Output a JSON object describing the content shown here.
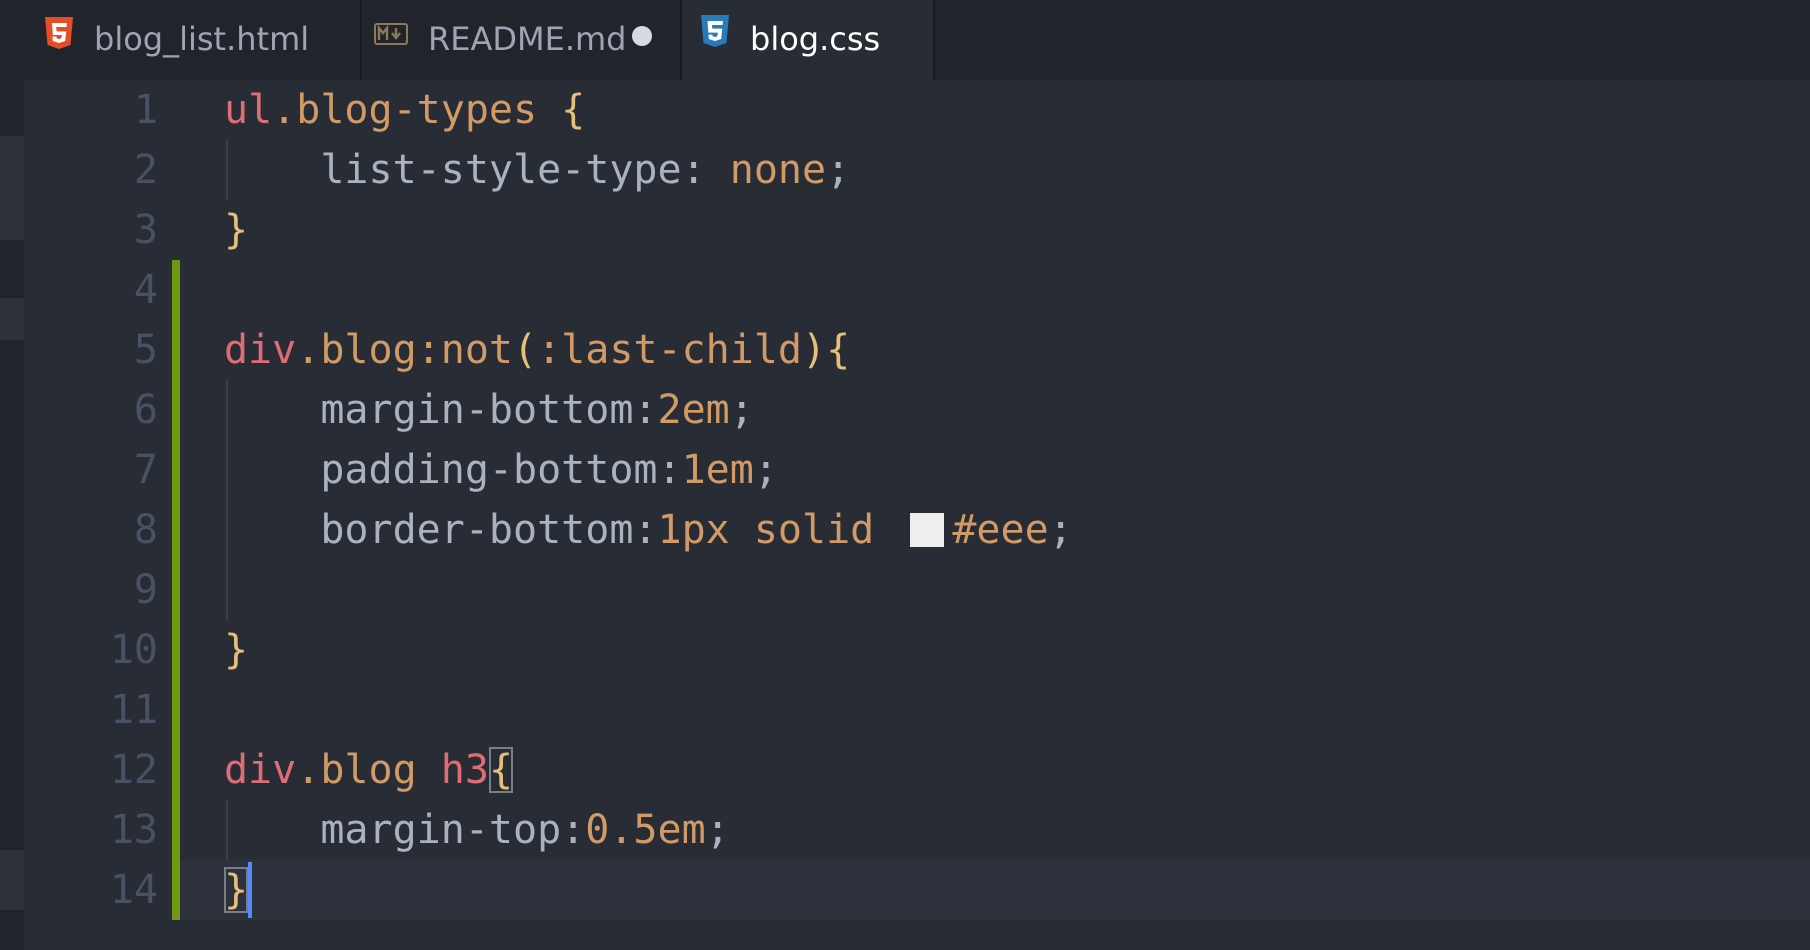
{
  "tabs": [
    {
      "label": "blog_list.html",
      "icon": "html5-icon",
      "active": false,
      "modified": false
    },
    {
      "label": "README.md",
      "icon": "markdown-icon",
      "active": false,
      "modified": true
    },
    {
      "label": "blog.css",
      "icon": "css3-icon",
      "active": true,
      "modified": false
    }
  ],
  "colors": {
    "swatch": "#eeeeee"
  },
  "editor": {
    "lines": [
      {
        "n": "1",
        "tokens": [
          {
            "t": "ul",
            "c": "tag"
          },
          {
            "t": ".blog-types",
            "c": "cls"
          },
          {
            "t": " ",
            "c": "punc"
          },
          {
            "t": "{",
            "c": "brace"
          }
        ]
      },
      {
        "n": "2",
        "tokens": [
          {
            "t": "    list-style-type",
            "c": "prop"
          },
          {
            "t": ": ",
            "c": "punc"
          },
          {
            "t": "none",
            "c": "val"
          },
          {
            "t": ";",
            "c": "punc"
          }
        ]
      },
      {
        "n": "3",
        "tokens": [
          {
            "t": "}",
            "c": "brace"
          }
        ]
      },
      {
        "n": "4",
        "tokens": []
      },
      {
        "n": "5",
        "tokens": [
          {
            "t": "div",
            "c": "tag"
          },
          {
            "t": ".blog",
            "c": "cls"
          },
          {
            "t": ":not",
            "c": "pseudo"
          },
          {
            "t": "(",
            "c": "brace"
          },
          {
            "t": ":last-child",
            "c": "pseudo"
          },
          {
            "t": ")",
            "c": "brace"
          },
          {
            "t": "{",
            "c": "brace"
          }
        ]
      },
      {
        "n": "6",
        "tokens": [
          {
            "t": "    margin-bottom",
            "c": "prop"
          },
          {
            "t": ":",
            "c": "punc"
          },
          {
            "t": "2em",
            "c": "val"
          },
          {
            "t": ";",
            "c": "punc"
          }
        ]
      },
      {
        "n": "7",
        "tokens": [
          {
            "t": "    padding-bottom",
            "c": "prop"
          },
          {
            "t": ":",
            "c": "punc"
          },
          {
            "t": "1em",
            "c": "val"
          },
          {
            "t": ";",
            "c": "punc"
          }
        ]
      },
      {
        "n": "8",
        "tokens": [
          {
            "t": "    border-bottom",
            "c": "prop"
          },
          {
            "t": ":",
            "c": "punc"
          },
          {
            "t": "1px solid ",
            "c": "val"
          },
          {
            "t": "",
            "c": "swatch"
          },
          {
            "t": "#eee",
            "c": "val"
          },
          {
            "t": ";",
            "c": "punc"
          }
        ]
      },
      {
        "n": "9",
        "tokens": []
      },
      {
        "n": "10",
        "tokens": [
          {
            "t": "}",
            "c": "brace"
          }
        ]
      },
      {
        "n": "11",
        "tokens": []
      },
      {
        "n": "12",
        "tokens": [
          {
            "t": "div",
            "c": "tag"
          },
          {
            "t": ".blog",
            "c": "cls"
          },
          {
            "t": " ",
            "c": "punc"
          },
          {
            "t": "h3",
            "c": "tag"
          },
          {
            "t": "{",
            "c": "brace-match"
          }
        ]
      },
      {
        "n": "13",
        "tokens": [
          {
            "t": "    margin-top",
            "c": "prop"
          },
          {
            "t": ":",
            "c": "punc"
          },
          {
            "t": "0.5em",
            "c": "val"
          },
          {
            "t": ";",
            "c": "punc"
          }
        ]
      },
      {
        "n": "14",
        "tokens": [
          {
            "t": "}",
            "c": "brace-match"
          }
        ]
      }
    ]
  }
}
